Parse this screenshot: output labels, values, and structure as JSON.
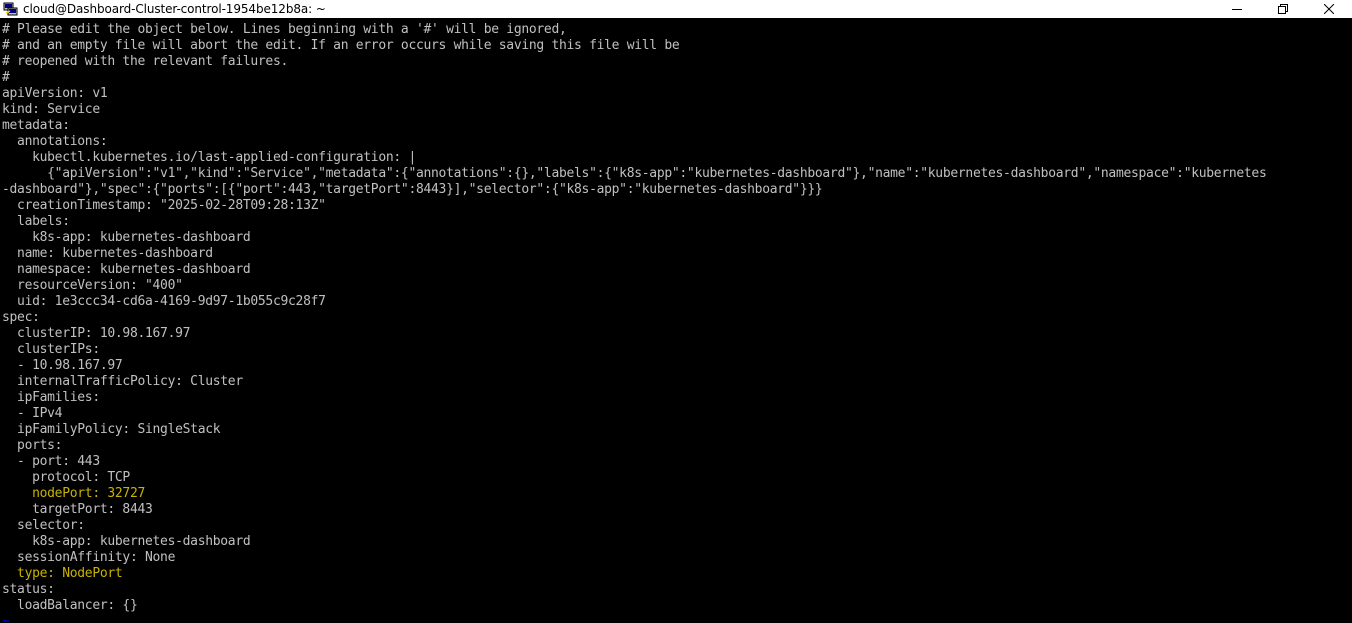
{
  "window": {
    "title": "cloud@Dashboard-Cluster-control-1954be12b8a: ~",
    "icons": {
      "app": "putty-icon",
      "minimize": "minimize-icon",
      "maximize": "restore-icon",
      "close": "close-icon"
    }
  },
  "terminal": {
    "lines": [
      {
        "text": "# Please edit the object below. Lines beginning with a '#' will be ignored,",
        "color": "#c0c0c0"
      },
      {
        "text": "# and an empty file will abort the edit. If an error occurs while saving this file will be",
        "color": "#c0c0c0"
      },
      {
        "text": "# reopened with the relevant failures.",
        "color": "#c0c0c0"
      },
      {
        "text": "#",
        "color": "#c0c0c0"
      },
      {
        "text": "apiVersion: v1",
        "color": "#c0c0c0"
      },
      {
        "text": "kind: Service",
        "color": "#c0c0c0"
      },
      {
        "text": "metadata:",
        "color": "#c0c0c0"
      },
      {
        "text": "  annotations:",
        "color": "#c0c0c0"
      },
      {
        "text": "    kubectl.kubernetes.io/last-applied-configuration: |",
        "color": "#c0c0c0"
      },
      {
        "text": "      {\"apiVersion\":\"v1\",\"kind\":\"Service\",\"metadata\":{\"annotations\":{},\"labels\":{\"k8s-app\":\"kubernetes-dashboard\"},\"name\":\"kubernetes-dashboard\",\"namespace\":\"kubernetes",
        "color": "#c0c0c0"
      },
      {
        "text": "-dashboard\"},\"spec\":{\"ports\":[{\"port\":443,\"targetPort\":8443}],\"selector\":{\"k8s-app\":\"kubernetes-dashboard\"}}}",
        "color": "#c0c0c0"
      },
      {
        "text": "  creationTimestamp: \"2025-02-28T09:28:13Z\"",
        "color": "#c0c0c0"
      },
      {
        "text": "  labels:",
        "color": "#c0c0c0"
      },
      {
        "text": "    k8s-app: kubernetes-dashboard",
        "color": "#c0c0c0"
      },
      {
        "text": "  name: kubernetes-dashboard",
        "color": "#c0c0c0"
      },
      {
        "text": "  namespace: kubernetes-dashboard",
        "color": "#c0c0c0"
      },
      {
        "text": "  resourceVersion: \"400\"",
        "color": "#c0c0c0"
      },
      {
        "text": "  uid: 1e3ccc34-cd6a-4169-9d97-1b055c9c28f7",
        "color": "#c0c0c0"
      },
      {
        "text": "spec:",
        "color": "#c0c0c0"
      },
      {
        "text": "  clusterIP: 10.98.167.97",
        "color": "#c0c0c0"
      },
      {
        "text": "  clusterIPs:",
        "color": "#c0c0c0"
      },
      {
        "text": "  - 10.98.167.97",
        "color": "#c0c0c0"
      },
      {
        "text": "  internalTrafficPolicy: Cluster",
        "color": "#c0c0c0"
      },
      {
        "text": "  ipFamilies:",
        "color": "#c0c0c0"
      },
      {
        "text": "  - IPv4",
        "color": "#c0c0c0"
      },
      {
        "text": "  ipFamilyPolicy: SingleStack",
        "color": "#c0c0c0"
      },
      {
        "text": "  ports:",
        "color": "#c0c0c0"
      },
      {
        "text": "  - port: 443",
        "color": "#c0c0c0"
      },
      {
        "text": "    protocol: TCP",
        "color": "#c0c0c0"
      },
      {
        "text": "    nodePort: 32727",
        "color": "#c8b400"
      },
      {
        "text": "    targetPort: 8443",
        "color": "#c0c0c0"
      },
      {
        "text": "  selector:",
        "color": "#c0c0c0"
      },
      {
        "text": "    k8s-app: kubernetes-dashboard",
        "color": "#c0c0c0"
      },
      {
        "text": "  sessionAffinity: None",
        "color": "#c0c0c0"
      },
      {
        "text": "  type: NodePort",
        "color": "#c8b400"
      },
      {
        "text": "status:",
        "color": "#c0c0c0"
      },
      {
        "text": "  loadBalancer: {}",
        "color": "#c0c0c0"
      },
      {
        "text": "~",
        "color": "#0000ff"
      }
    ]
  }
}
